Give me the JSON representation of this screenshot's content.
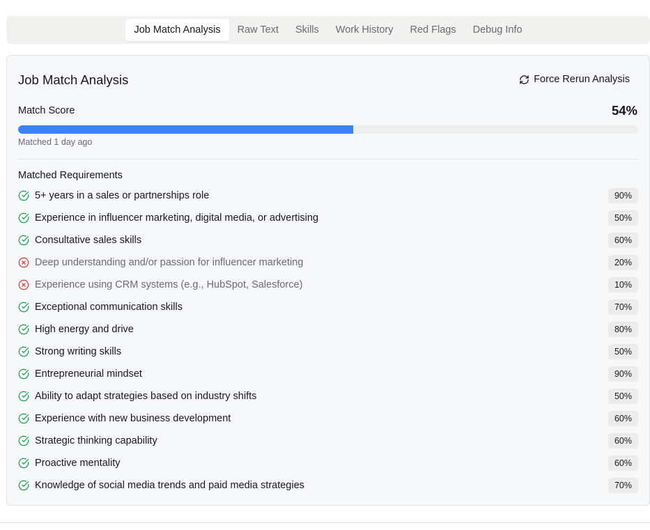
{
  "tabs": [
    {
      "label": "Job Match Analysis",
      "active": true
    },
    {
      "label": "Raw Text",
      "active": false
    },
    {
      "label": "Skills",
      "active": false
    },
    {
      "label": "Work History",
      "active": false
    },
    {
      "label": "Red Flags",
      "active": false
    },
    {
      "label": "Debug Info",
      "active": false
    }
  ],
  "card": {
    "title": "Job Match Analysis",
    "rerun_label": "Force Rerun Analysis",
    "rerun_icon": "refresh-icon"
  },
  "score": {
    "label": "Match Score",
    "value_text": "54%",
    "progress_fraction": 0.54,
    "matched_time": "Matched 1 day ago"
  },
  "colors": {
    "progress": "#3b82f6",
    "matched_icon": "#22a55a",
    "unmatched_icon": "#e0453b"
  },
  "requirements": {
    "heading": "Matched Requirements",
    "items": [
      {
        "text": "5+ years in a sales or partnerships role",
        "pct": "90%",
        "matched": true
      },
      {
        "text": "Experience in influencer marketing, digital media, or advertising",
        "pct": "50%",
        "matched": true
      },
      {
        "text": "Consultative sales skills",
        "pct": "60%",
        "matched": true
      },
      {
        "text": "Deep understanding and/or passion for influencer marketing",
        "pct": "20%",
        "matched": false
      },
      {
        "text": "Experience using CRM systems (e.g., HubSpot, Salesforce)",
        "pct": "10%",
        "matched": false
      },
      {
        "text": "Exceptional communication skills",
        "pct": "70%",
        "matched": true
      },
      {
        "text": "High energy and drive",
        "pct": "80%",
        "matched": true
      },
      {
        "text": "Strong writing skills",
        "pct": "50%",
        "matched": true
      },
      {
        "text": "Entrepreneurial mindset",
        "pct": "90%",
        "matched": true
      },
      {
        "text": "Ability to adapt strategies based on industry shifts",
        "pct": "50%",
        "matched": true
      },
      {
        "text": "Experience with new business development",
        "pct": "60%",
        "matched": true
      },
      {
        "text": "Strategic thinking capability",
        "pct": "60%",
        "matched": true
      },
      {
        "text": "Proactive mentality",
        "pct": "60%",
        "matched": true
      },
      {
        "text": "Knowledge of social media trends and paid media strategies",
        "pct": "70%",
        "matched": true
      }
    ]
  }
}
